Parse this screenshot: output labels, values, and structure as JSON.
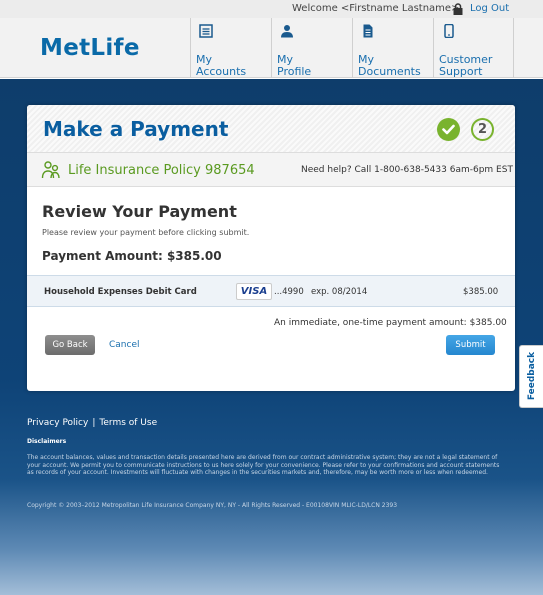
{
  "topbar": {
    "welcome": "Welcome <Firstname Lastname>",
    "logout": "Log Out"
  },
  "header": {
    "logo": "MetLife",
    "nav": [
      {
        "label1": "My",
        "label2": "Accounts",
        "icon": "list-icon"
      },
      {
        "label1": "My",
        "label2": "Profile",
        "icon": "person-icon"
      },
      {
        "label1": "My",
        "label2": "Documents",
        "icon": "document-icon"
      },
      {
        "label1": "Customer",
        "label2": "Support",
        "icon": "phone-icon"
      }
    ]
  },
  "payment": {
    "title": "Make a Payment",
    "steps": [
      {
        "state": "complete",
        "icon": "checkmark-icon"
      },
      {
        "label": "2",
        "state": "current"
      }
    ],
    "policy": "Life Insurance Policy 987654",
    "help": "Need help? Call 1-800-638-5433 6am-6pm EST",
    "review_title": "Review Your Payment",
    "review_subtitle": "Please review your payment before clicking submit.",
    "amount_label": "Payment Amount: $385.00",
    "method": {
      "name": "Household Expenses Debit Card",
      "brand": "VISA",
      "last4": "...4990",
      "expiry": "exp. 08/2014",
      "amount": "$385.00"
    },
    "summary": "An immediate, one-time payment amount: $385.00",
    "go_back": "Go Back",
    "cancel": "Cancel",
    "submit": "Submit"
  },
  "feedback": "Feedback",
  "footer": {
    "privacy": "Privacy Policy",
    "separator": "|",
    "terms": "Terms of Use",
    "disclaimers_title": "Disclaimers",
    "disclaimer": "The account balances, values and transaction details presented here are derived from our contract administrative system; they are not a legal statement of your account. We permit you to communicate instructions to us here solely for your convenience. Please refer to your confirmations and account statements as records of your account. Investments will fluctuate with changes in the securities markets and, therefore, may be worth more or less when redeemed.",
    "copyright": "Copyright © 2003–2012 Metropolitan Life Insurance Company NY, NY - All Rights Reserved - E00108VIN MLIC-LD/LCN 2393"
  },
  "colors": {
    "brand_blue": "#0a6aa8",
    "page_blue": "#0e3d6b",
    "success_green": "#79b32e",
    "submit_blue": "#2587cf"
  }
}
